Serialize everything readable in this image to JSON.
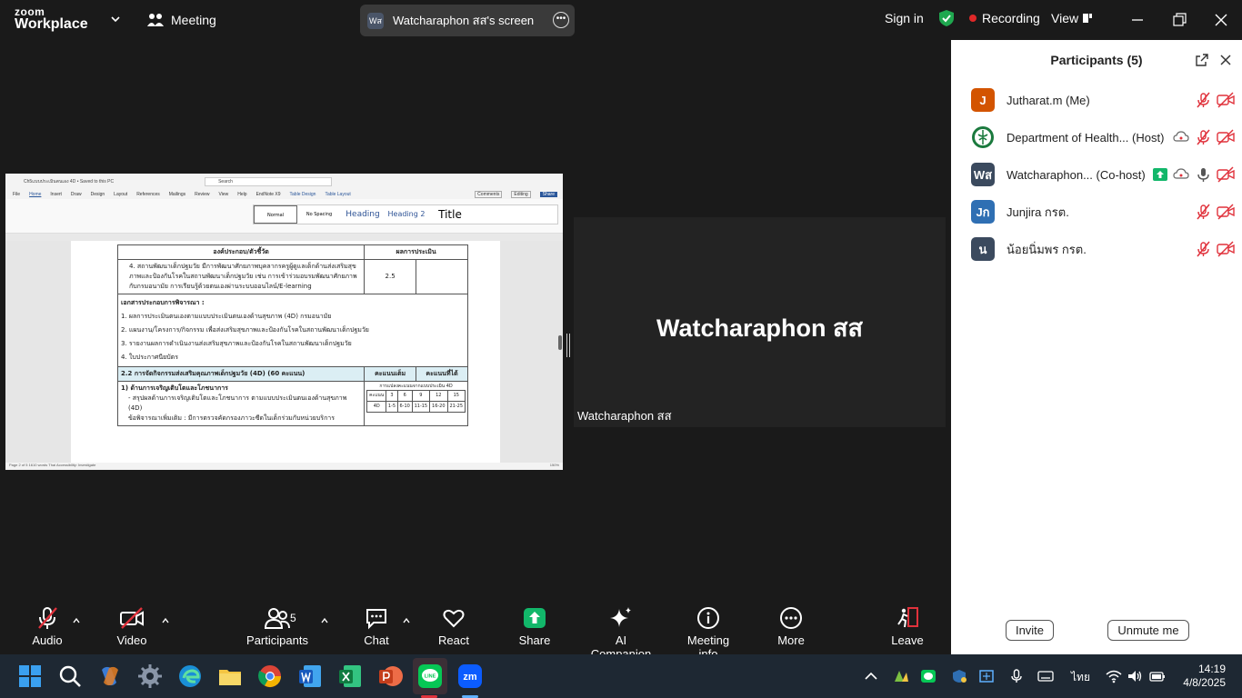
{
  "app": {
    "logo_line1": "zoom",
    "logo_line2": "Workplace",
    "meeting_label": "Meeting",
    "screen_label": "Watcharaphon สส's screen",
    "screen_avatar": "Wส",
    "sign_in": "Sign in",
    "recording_label": "Recording",
    "view_label": "View"
  },
  "shared_window": {
    "title": "Ch5แบบประเมินตนเอง 4D • Saved to this PC",
    "search_placeholder": "Search",
    "menu": [
      "File",
      "Home",
      "Insert",
      "Draw",
      "Design",
      "Layout",
      "References",
      "Mailings",
      "Review",
      "View",
      "Help",
      "EndNote X9",
      "Table Design",
      "Table Layout"
    ],
    "styles": [
      "Normal",
      "No Spacing",
      "Heading",
      "Heading 2",
      "Title"
    ],
    "share_button": "Share",
    "comments_button": "Comments",
    "editing_button": "Editing",
    "status_text": "Page 2 of 5    1610 words    Thai    Accessibility: Investigate",
    "zoom_level": "150%",
    "table": {
      "header_left": "องค์ประกอบ/ตัวชี้วัด",
      "header_right": "ผลการประเมิน",
      "row1_text": "4. สถานพัฒนาเด็กปฐมวัย มีการพัฒนาศักยภาพบุคลากรครูผู้ดูแลเด็กด้านส่งเสริมสุขภาพและป้องกันโรคในสถานพัฒนาเด็กปฐมวัย เช่น การเข้าร่วมอบรมพัฒนาศักยภาพกับกรมอนามัย การเรียนรู้ด้วยตนเองผ่านระบบออนไลน์/E-learning",
      "row1_score": "2.5",
      "docs_heading": "เอกสารประกอบการพิจารณา :",
      "docs": [
        "1. ผลการประเมินตนเองตามแบบประเมินตนเองด้านสุขภาพ (4D) กรมอนามัย",
        "2. แผนงาน/โครงการ/กิจกรรม เพื่อส่งเสริมสุขภาพและป้องกันโรคในสถานพัฒนาเด็กปฐมวัย",
        "3. รายงานผลการดำเนินงานส่งเสริมสุขภาพและป้องกันโรคในสถานพัฒนาเด็กปฐมวัย",
        "4. ใบประกาศนียบัตร"
      ],
      "section_title": "2.2 การจัดกิจกรรมส่งเสริมคุณภาพเด็กปฐมวัย (4D) (60 คะแนน)",
      "section_col1": "คะแนนเต็ม",
      "section_col2": "คะแนนที่ได้",
      "growth_heading": "1) ด้านการเจริญเติบโตและโภชนาการ",
      "growth_text": "- สรุปผลด้านการเจริญเติบโตและโภชนาการ ตามแบบประเมินตนเองด้านสุขภาพ (4D)",
      "growth_text2": "ข้อพิจารณาเพิ่มเติม : มีการตรวจคัดกรองภาวะซีดในเด็กร่วมกับหน่วยบริการ",
      "mini_caption": "การแปลงคะแนนจากแบบประเมิน 4D",
      "mini_head": [
        "คะแนน",
        "3",
        "6",
        "9",
        "12",
        "15"
      ],
      "mini_row": [
        "4D",
        "1-5",
        "6-10",
        "11-15",
        "16-20",
        "21-25"
      ]
    }
  },
  "video": {
    "name": "Watcharaphon สส",
    "label": "Watcharaphon สส"
  },
  "participants": {
    "title": "Participants (5)",
    "invite": "Invite",
    "unmute_me": "Unmute me",
    "list": [
      {
        "initial": "J",
        "name": "Jutharat.m (Me)",
        "color": "#d35400"
      },
      {
        "initial": "",
        "name": "Department of Health... (Host)",
        "color": "#ffffff"
      },
      {
        "initial": "Wส",
        "name": "Watcharaphon... (Co-host)",
        "color": "#3b4a5e"
      },
      {
        "initial": "Jก",
        "name": "Junjira กรต.",
        "color": "#2f6fb3"
      },
      {
        "initial": "น",
        "name": "น้อยนิ่มพร กรต.",
        "color": "#3b4a5e"
      }
    ]
  },
  "toolbar": {
    "audio": "Audio",
    "video": "Video",
    "participants": "Participants",
    "participants_count": "5",
    "chat": "Chat",
    "react": "React",
    "share": "Share",
    "ai_companion": "AI Companion",
    "meeting_info": "Meeting info",
    "more": "More",
    "leave": "Leave"
  },
  "taskbar": {
    "lang": "ไทย",
    "time": "14:19",
    "date": "4/8/2025"
  },
  "colors": {
    "share_green": "#12b76a",
    "leave_red": "#e0323c",
    "record_red": "#e02828",
    "shield_green": "#1fa84f"
  }
}
